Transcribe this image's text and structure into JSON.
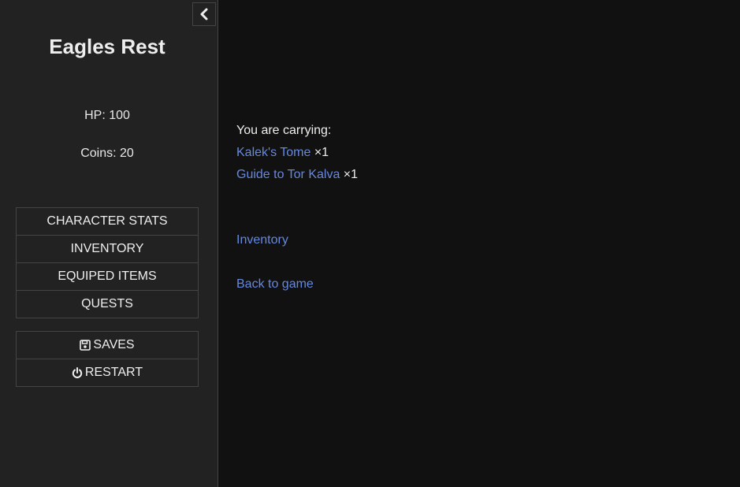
{
  "sidebar": {
    "toggle_icon": "chevron-left-icon",
    "title": "Eagles Rest",
    "hp": "HP: 100",
    "coins": "Coins: 20",
    "menu": [
      "CHARACTER STATS",
      "INVENTORY",
      "EQUIPED ITEMS",
      "QUESTS"
    ],
    "saves_label": "SAVES",
    "saves_icon": "floppy-disk-icon",
    "restart_label": "RESTART",
    "restart_icon": "power-icon"
  },
  "passage": {
    "intro": "You are carrying:",
    "items": [
      {
        "name": "Kalek's Tome",
        "qty": "×1"
      },
      {
        "name": "Guide to Tor Kalva",
        "qty": "×1"
      }
    ],
    "inventory_link": "Inventory",
    "back_link": "Back to game"
  },
  "colors": {
    "background": "#111111",
    "sidebar": "#222222",
    "link": "#6688dd",
    "text": "#eeeeee"
  }
}
